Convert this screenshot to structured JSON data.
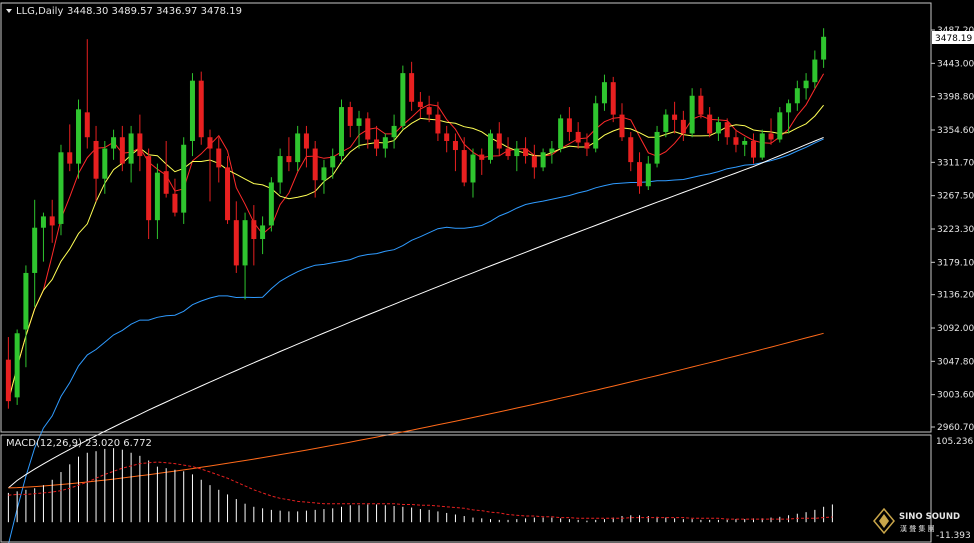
{
  "header": {
    "symbol_label": "LLG,Daily",
    "ohlc_text": "3448.30 3489.57 3436.97 3478.19"
  },
  "macd_panel": {
    "label": "MACD(12,26,9) 23.020 6.772",
    "axis_top": "105.236",
    "axis_bottom": "-11.393"
  },
  "watermark": {
    "brand": "SINO SOUND",
    "subtitle": "漢 聲 集 團"
  },
  "colors": {
    "background": "#000000",
    "frame": "#c8c8c8",
    "bull": "#2fc52f",
    "bear": "#e82020",
    "ma_fast": "#ff2a2a",
    "ma_mid": "#ffff55",
    "ma_slow": "#2f9bff",
    "ma_long": "#ffffff",
    "ma_vlong": "#ff6a1a",
    "macd_hist": "#ffffff",
    "macd_signal": "#e82020"
  },
  "chart_data": {
    "type": "candlestick",
    "price_axis": {
      "ylim": [
        2960.7,
        3487.2
      ],
      "ticks": [
        "3487.20",
        "3443.00",
        "3398.80",
        "3354.60",
        "3311.70",
        "3267.50",
        "3223.30",
        "3179.10",
        "3136.20",
        "3092.00",
        "3047.80",
        "3003.60",
        "2960.70"
      ],
      "current_price": "3478.19"
    },
    "candles": [
      [
        3050,
        3080,
        2985,
        2995
      ],
      [
        3000,
        3090,
        2990,
        3085
      ],
      [
        3090,
        3175,
        3040,
        3165
      ],
      [
        3165,
        3262,
        3120,
        3225
      ],
      [
        3225,
        3245,
        3180,
        3240
      ],
      [
        3240,
        3262,
        3205,
        3228
      ],
      [
        3230,
        3335,
        3215,
        3325
      ],
      [
        3325,
        3362,
        3300,
        3310
      ],
      [
        3310,
        3395,
        3290,
        3382
      ],
      [
        3378,
        3475,
        3330,
        3345
      ],
      [
        3340,
        3360,
        3260,
        3290
      ],
      [
        3290,
        3340,
        3270,
        3330
      ],
      [
        3330,
        3355,
        3315,
        3345
      ],
      [
        3345,
        3360,
        3300,
        3310
      ],
      [
        3310,
        3360,
        3285,
        3350
      ],
      [
        3350,
        3375,
        3300,
        3320
      ],
      [
        3320,
        3330,
        3210,
        3235
      ],
      [
        3235,
        3310,
        3210,
        3298
      ],
      [
        3300,
        3340,
        3265,
        3270
      ],
      [
        3270,
        3290,
        3240,
        3245
      ],
      [
        3245,
        3345,
        3230,
        3335
      ],
      [
        3340,
        3430,
        3320,
        3420
      ],
      [
        3420,
        3432,
        3335,
        3345
      ],
      [
        3345,
        3355,
        3260,
        3330
      ],
      [
        3330,
        3345,
        3285,
        3305
      ],
      [
        3305,
        3320,
        3230,
        3235
      ],
      [
        3235,
        3260,
        3165,
        3175
      ],
      [
        3175,
        3245,
        3130,
        3235
      ],
      [
        3235,
        3255,
        3175,
        3210
      ],
      [
        3210,
        3240,
        3190,
        3228
      ],
      [
        3228,
        3292,
        3220,
        3285
      ],
      [
        3285,
        3330,
        3270,
        3320
      ],
      [
        3320,
        3345,
        3300,
        3312
      ],
      [
        3312,
        3360,
        3300,
        3350
      ],
      [
        3350,
        3360,
        3305,
        3330
      ],
      [
        3330,
        3340,
        3265,
        3288
      ],
      [
        3288,
        3315,
        3270,
        3305
      ],
      [
        3305,
        3330,
        3290,
        3320
      ],
      [
        3320,
        3395,
        3310,
        3385
      ],
      [
        3385,
        3392,
        3345,
        3360
      ],
      [
        3360,
        3380,
        3330,
        3370
      ],
      [
        3370,
        3378,
        3330,
        3342
      ],
      [
        3342,
        3360,
        3320,
        3330
      ],
      [
        3330,
        3350,
        3318,
        3345
      ],
      [
        3345,
        3375,
        3330,
        3360
      ],
      [
        3360,
        3440,
        3355,
        3430
      ],
      [
        3430,
        3445,
        3380,
        3392
      ],
      [
        3392,
        3405,
        3370,
        3385
      ],
      [
        3385,
        3400,
        3365,
        3375
      ],
      [
        3375,
        3392,
        3340,
        3350
      ],
      [
        3350,
        3360,
        3325,
        3340
      ],
      [
        3340,
        3350,
        3300,
        3328
      ],
      [
        3328,
        3345,
        3280,
        3285
      ],
      [
        3285,
        3330,
        3265,
        3322
      ],
      [
        3322,
        3330,
        3295,
        3315
      ],
      [
        3315,
        3355,
        3310,
        3350
      ],
      [
        3350,
        3365,
        3320,
        3330
      ],
      [
        3330,
        3345,
        3315,
        3320
      ],
      [
        3320,
        3340,
        3300,
        3330
      ],
      [
        3330,
        3345,
        3310,
        3320
      ],
      [
        3320,
        3335,
        3290,
        3305
      ],
      [
        3305,
        3330,
        3300,
        3325
      ],
      [
        3325,
        3340,
        3310,
        3330
      ],
      [
        3330,
        3375,
        3325,
        3370
      ],
      [
        3370,
        3385,
        3340,
        3352
      ],
      [
        3352,
        3365,
        3330,
        3338
      ],
      [
        3338,
        3350,
        3320,
        3330
      ],
      [
        3330,
        3400,
        3325,
        3390
      ],
      [
        3390,
        3428,
        3380,
        3418
      ],
      [
        3418,
        3425,
        3365,
        3375
      ],
      [
        3375,
        3390,
        3340,
        3345
      ],
      [
        3345,
        3352,
        3300,
        3312
      ],
      [
        3312,
        3325,
        3270,
        3280
      ],
      [
        3280,
        3320,
        3275,
        3310
      ],
      [
        3310,
        3360,
        3305,
        3352
      ],
      [
        3352,
        3382,
        3345,
        3375
      ],
      [
        3375,
        3392,
        3350,
        3368
      ],
      [
        3368,
        3380,
        3340,
        3350
      ],
      [
        3350,
        3410,
        3345,
        3400
      ],
      [
        3400,
        3410,
        3370,
        3375
      ],
      [
        3375,
        3385,
        3345,
        3350
      ],
      [
        3350,
        3372,
        3340,
        3365
      ],
      [
        3365,
        3370,
        3335,
        3345
      ],
      [
        3345,
        3355,
        3325,
        3335
      ],
      [
        3335,
        3345,
        3320,
        3340
      ],
      [
        3340,
        3350,
        3310,
        3318
      ],
      [
        3318,
        3355,
        3315,
        3350
      ],
      [
        3350,
        3370,
        3335,
        3342
      ],
      [
        3342,
        3385,
        3338,
        3378
      ],
      [
        3378,
        3395,
        3350,
        3390
      ],
      [
        3390,
        3420,
        3380,
        3410
      ],
      [
        3410,
        3430,
        3395,
        3420
      ],
      [
        3418,
        3460,
        3410,
        3448
      ],
      [
        3448,
        3489.57,
        3436.97,
        3478.19
      ]
    ],
    "macd_axis": {
      "ylim": [
        -11.393,
        105.236
      ]
    },
    "macd": {
      "label": "MACD(12,26,9)",
      "value": 23.02,
      "signal_value": 6.772,
      "histogram": [
        38,
        40,
        42,
        44,
        48,
        55,
        65,
        75,
        85,
        90,
        92,
        95,
        96,
        94,
        90,
        86,
        80,
        72,
        70,
        68,
        66,
        62,
        55,
        48,
        42,
        36,
        30,
        24,
        20,
        18,
        16,
        15,
        14,
        14,
        15,
        16,
        17,
        18,
        20,
        22,
        22,
        23,
        23,
        22,
        21,
        20,
        19,
        17,
        16,
        14,
        12,
        10,
        8,
        6,
        5,
        4,
        3,
        3,
        4,
        5,
        6,
        6,
        6,
        5,
        4,
        3,
        2,
        3,
        4,
        6,
        8,
        9,
        9,
        8,
        7,
        6,
        5,
        4,
        4,
        3,
        3,
        3,
        3,
        4,
        4,
        5,
        5,
        6,
        7,
        9,
        11,
        13,
        16,
        20,
        23.02
      ],
      "signal": [
        35,
        36,
        36,
        37,
        38,
        39,
        41,
        44,
        48,
        52,
        57,
        62,
        66,
        70,
        73,
        76,
        77,
        78,
        77,
        76,
        74,
        72,
        69,
        65,
        61,
        57,
        52,
        47,
        42,
        38,
        34,
        31,
        29,
        27,
        26,
        25,
        24,
        24,
        24,
        24,
        24,
        24,
        24,
        24,
        24,
        23,
        23,
        22,
        22,
        21,
        20,
        19,
        18,
        16,
        15,
        13,
        12,
        10,
        9,
        8,
        8,
        7,
        7,
        6,
        6,
        5,
        5,
        5,
        5,
        5,
        5,
        6,
        6,
        6,
        6,
        6,
        6,
        6,
        5,
        5,
        5,
        5,
        4,
        4,
        4,
        4,
        4,
        4,
        4,
        4,
        5,
        5,
        5,
        6,
        6.772
      ]
    }
  }
}
